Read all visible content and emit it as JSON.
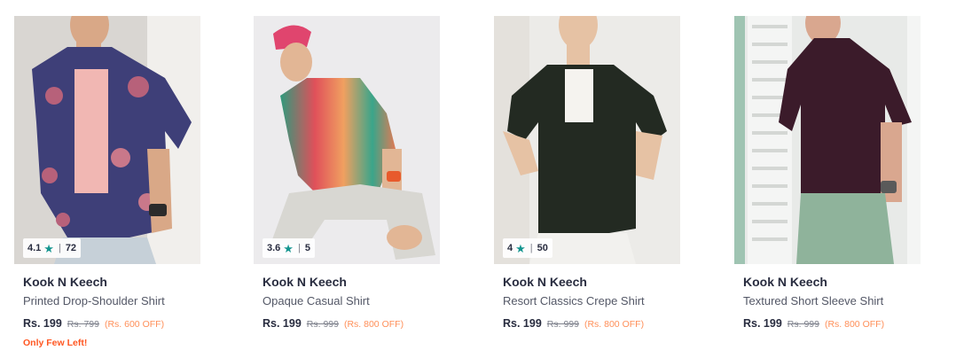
{
  "products": [
    {
      "brand": "Kook N Keech",
      "name": "Printed Drop-Shoulder Shirt",
      "rating": "4.1",
      "rating_count": "72",
      "price": "Rs. 199",
      "mrp": "Rs. 799",
      "discount": "(Rs. 600 OFF)",
      "stock_note": "Only Few Left!",
      "image_colors": {
        "bg": "#d9d6d2",
        "shirt": "#3e3f78",
        "pattern": "#b7617a",
        "inner": "#f1b7b3",
        "pants": "#c6d0d8"
      }
    },
    {
      "brand": "Kook N Keech",
      "name": "Opaque Casual Shirt",
      "rating": "3.6",
      "rating_count": "5",
      "price": "Rs. 199",
      "mrp": "Rs. 999",
      "discount": "(Rs. 800 OFF)",
      "stock_note": "",
      "image_colors": {
        "bg": "#ecebed",
        "shirt": "#e06a55",
        "pattern": "#2f9a7c",
        "inner": "#e8c9a8",
        "pants": "#d8d7d2"
      }
    },
    {
      "brand": "Kook N Keech",
      "name": "Resort Classics Crepe Shirt",
      "rating": "4",
      "rating_count": "50",
      "price": "Rs. 199",
      "mrp": "Rs. 999",
      "discount": "(Rs. 800 OFF)",
      "stock_note": "",
      "image_colors": {
        "bg": "#ecebe8",
        "shirt": "#232a22",
        "pattern": "#232a22",
        "inner": "#f5f3ef",
        "pants": "#f2f1ee"
      }
    },
    {
      "brand": "Kook N Keech",
      "name": "Textured Short Sleeve Shirt",
      "rating": "",
      "rating_count": "",
      "price": "Rs. 199",
      "mrp": "Rs. 999",
      "discount": "(Rs. 800 OFF)",
      "stock_note": "",
      "image_colors": {
        "bg": "#e8eae8",
        "shirt": "#3b1b2a",
        "pattern": "#3b1b2a",
        "inner": "#d9a78f",
        "pants": "#8fb39b"
      }
    }
  ],
  "rating_star": "★",
  "rating_separator": "|",
  "accent_colors": {
    "star": "#14958f",
    "discount": "#ff905a",
    "stock": "#ff5722"
  }
}
